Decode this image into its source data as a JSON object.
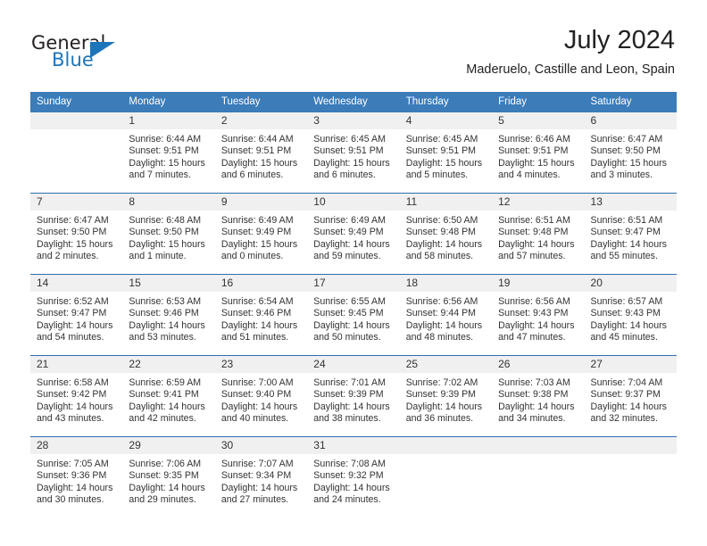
{
  "logo": {
    "primary_text": "General",
    "secondary_text": "Blue",
    "primary_color": "#231f20",
    "secondary_color": "#1b75bb"
  },
  "header": {
    "title": "July 2024",
    "subtitle": "Maderuelo, Castille and Leon, Spain"
  },
  "theme": {
    "header_row_bg": "#3b7cb9",
    "header_row_text": "#ffffff",
    "daynum_band_bg": "#f0f0f0",
    "week_separator": "#2f6eaf",
    "body_text": "#333333"
  },
  "calendar": {
    "weekday_headers": [
      "Sunday",
      "Monday",
      "Tuesday",
      "Wednesday",
      "Thursday",
      "Friday",
      "Saturday"
    ],
    "weeks": [
      [
        {
          "day": ""
        },
        {
          "day": "1",
          "sunrise": "Sunrise: 6:44 AM",
          "sunset": "Sunset: 9:51 PM",
          "daylight": "Daylight: 15 hours and 7 minutes."
        },
        {
          "day": "2",
          "sunrise": "Sunrise: 6:44 AM",
          "sunset": "Sunset: 9:51 PM",
          "daylight": "Daylight: 15 hours and 6 minutes."
        },
        {
          "day": "3",
          "sunrise": "Sunrise: 6:45 AM",
          "sunset": "Sunset: 9:51 PM",
          "daylight": "Daylight: 15 hours and 6 minutes."
        },
        {
          "day": "4",
          "sunrise": "Sunrise: 6:45 AM",
          "sunset": "Sunset: 9:51 PM",
          "daylight": "Daylight: 15 hours and 5 minutes."
        },
        {
          "day": "5",
          "sunrise": "Sunrise: 6:46 AM",
          "sunset": "Sunset: 9:51 PM",
          "daylight": "Daylight: 15 hours and 4 minutes."
        },
        {
          "day": "6",
          "sunrise": "Sunrise: 6:47 AM",
          "sunset": "Sunset: 9:50 PM",
          "daylight": "Daylight: 15 hours and 3 minutes."
        }
      ],
      [
        {
          "day": "7",
          "sunrise": "Sunrise: 6:47 AM",
          "sunset": "Sunset: 9:50 PM",
          "daylight": "Daylight: 15 hours and 2 minutes."
        },
        {
          "day": "8",
          "sunrise": "Sunrise: 6:48 AM",
          "sunset": "Sunset: 9:50 PM",
          "daylight": "Daylight: 15 hours and 1 minute."
        },
        {
          "day": "9",
          "sunrise": "Sunrise: 6:49 AM",
          "sunset": "Sunset: 9:49 PM",
          "daylight": "Daylight: 15 hours and 0 minutes."
        },
        {
          "day": "10",
          "sunrise": "Sunrise: 6:49 AM",
          "sunset": "Sunset: 9:49 PM",
          "daylight": "Daylight: 14 hours and 59 minutes."
        },
        {
          "day": "11",
          "sunrise": "Sunrise: 6:50 AM",
          "sunset": "Sunset: 9:48 PM",
          "daylight": "Daylight: 14 hours and 58 minutes."
        },
        {
          "day": "12",
          "sunrise": "Sunrise: 6:51 AM",
          "sunset": "Sunset: 9:48 PM",
          "daylight": "Daylight: 14 hours and 57 minutes."
        },
        {
          "day": "13",
          "sunrise": "Sunrise: 6:51 AM",
          "sunset": "Sunset: 9:47 PM",
          "daylight": "Daylight: 14 hours and 55 minutes."
        }
      ],
      [
        {
          "day": "14",
          "sunrise": "Sunrise: 6:52 AM",
          "sunset": "Sunset: 9:47 PM",
          "daylight": "Daylight: 14 hours and 54 minutes."
        },
        {
          "day": "15",
          "sunrise": "Sunrise: 6:53 AM",
          "sunset": "Sunset: 9:46 PM",
          "daylight": "Daylight: 14 hours and 53 minutes."
        },
        {
          "day": "16",
          "sunrise": "Sunrise: 6:54 AM",
          "sunset": "Sunset: 9:46 PM",
          "daylight": "Daylight: 14 hours and 51 minutes."
        },
        {
          "day": "17",
          "sunrise": "Sunrise: 6:55 AM",
          "sunset": "Sunset: 9:45 PM",
          "daylight": "Daylight: 14 hours and 50 minutes."
        },
        {
          "day": "18",
          "sunrise": "Sunrise: 6:56 AM",
          "sunset": "Sunset: 9:44 PM",
          "daylight": "Daylight: 14 hours and 48 minutes."
        },
        {
          "day": "19",
          "sunrise": "Sunrise: 6:56 AM",
          "sunset": "Sunset: 9:43 PM",
          "daylight": "Daylight: 14 hours and 47 minutes."
        },
        {
          "day": "20",
          "sunrise": "Sunrise: 6:57 AM",
          "sunset": "Sunset: 9:43 PM",
          "daylight": "Daylight: 14 hours and 45 minutes."
        }
      ],
      [
        {
          "day": "21",
          "sunrise": "Sunrise: 6:58 AM",
          "sunset": "Sunset: 9:42 PM",
          "daylight": "Daylight: 14 hours and 43 minutes."
        },
        {
          "day": "22",
          "sunrise": "Sunrise: 6:59 AM",
          "sunset": "Sunset: 9:41 PM",
          "daylight": "Daylight: 14 hours and 42 minutes."
        },
        {
          "day": "23",
          "sunrise": "Sunrise: 7:00 AM",
          "sunset": "Sunset: 9:40 PM",
          "daylight": "Daylight: 14 hours and 40 minutes."
        },
        {
          "day": "24",
          "sunrise": "Sunrise: 7:01 AM",
          "sunset": "Sunset: 9:39 PM",
          "daylight": "Daylight: 14 hours and 38 minutes."
        },
        {
          "day": "25",
          "sunrise": "Sunrise: 7:02 AM",
          "sunset": "Sunset: 9:39 PM",
          "daylight": "Daylight: 14 hours and 36 minutes."
        },
        {
          "day": "26",
          "sunrise": "Sunrise: 7:03 AM",
          "sunset": "Sunset: 9:38 PM",
          "daylight": "Daylight: 14 hours and 34 minutes."
        },
        {
          "day": "27",
          "sunrise": "Sunrise: 7:04 AM",
          "sunset": "Sunset: 9:37 PM",
          "daylight": "Daylight: 14 hours and 32 minutes."
        }
      ],
      [
        {
          "day": "28",
          "sunrise": "Sunrise: 7:05 AM",
          "sunset": "Sunset: 9:36 PM",
          "daylight": "Daylight: 14 hours and 30 minutes."
        },
        {
          "day": "29",
          "sunrise": "Sunrise: 7:06 AM",
          "sunset": "Sunset: 9:35 PM",
          "daylight": "Daylight: 14 hours and 29 minutes."
        },
        {
          "day": "30",
          "sunrise": "Sunrise: 7:07 AM",
          "sunset": "Sunset: 9:34 PM",
          "daylight": "Daylight: 14 hours and 27 minutes."
        },
        {
          "day": "31",
          "sunrise": "Sunrise: 7:08 AM",
          "sunset": "Sunset: 9:32 PM",
          "daylight": "Daylight: 14 hours and 24 minutes."
        },
        {
          "day": ""
        },
        {
          "day": ""
        },
        {
          "day": ""
        }
      ]
    ]
  }
}
